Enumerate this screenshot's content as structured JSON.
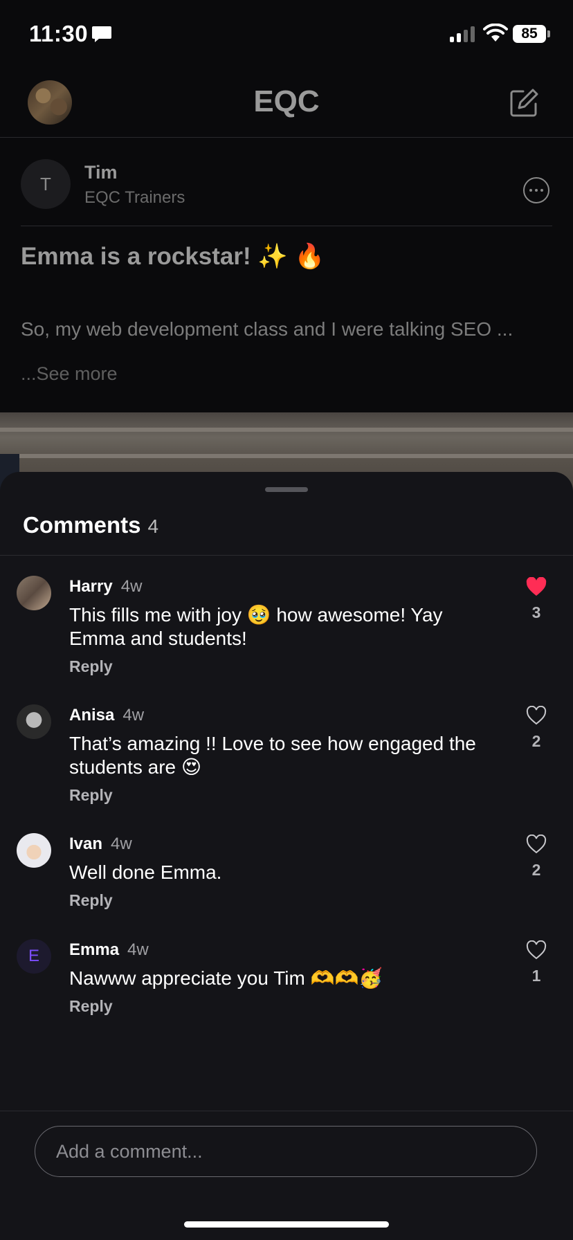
{
  "status_bar": {
    "time": "11:30",
    "battery": "85"
  },
  "header": {
    "title": "EQC"
  },
  "post": {
    "author_initial": "T",
    "author_name": "Tim",
    "author_group": "EQC Trainers",
    "title": "Emma is a rockstar! ✨ 🔥",
    "body_preview": "So, my web development class and I were talking SEO ...",
    "see_more": "...See more"
  },
  "comments_sheet": {
    "heading": "Comments",
    "count": "4",
    "reply_label": "Reply",
    "comments": [
      {
        "name": "Harry",
        "time": "4w",
        "text": "This fills me with joy 🥹 how awesome! Yay Emma and students!",
        "likes": "3",
        "liked": true
      },
      {
        "name": "Anisa",
        "time": "4w",
        "text": "That’s amazing !! Love to see how engaged the students are 😍",
        "likes": "2",
        "liked": false
      },
      {
        "name": "Ivan",
        "time": "4w",
        "text": "Well done Emma.",
        "likes": "2",
        "liked": false
      },
      {
        "name": "Emma",
        "initial": "E",
        "time": "4w",
        "text": "Nawww appreciate you Tim 🫶🫶🥳",
        "likes": "1",
        "liked": false
      }
    ]
  },
  "composer": {
    "placeholder": "Add a comment..."
  },
  "colors": {
    "liked_heart": "#ff2d55",
    "sheet_bg": "#141418",
    "emma_avatar": "#7c4dff"
  }
}
